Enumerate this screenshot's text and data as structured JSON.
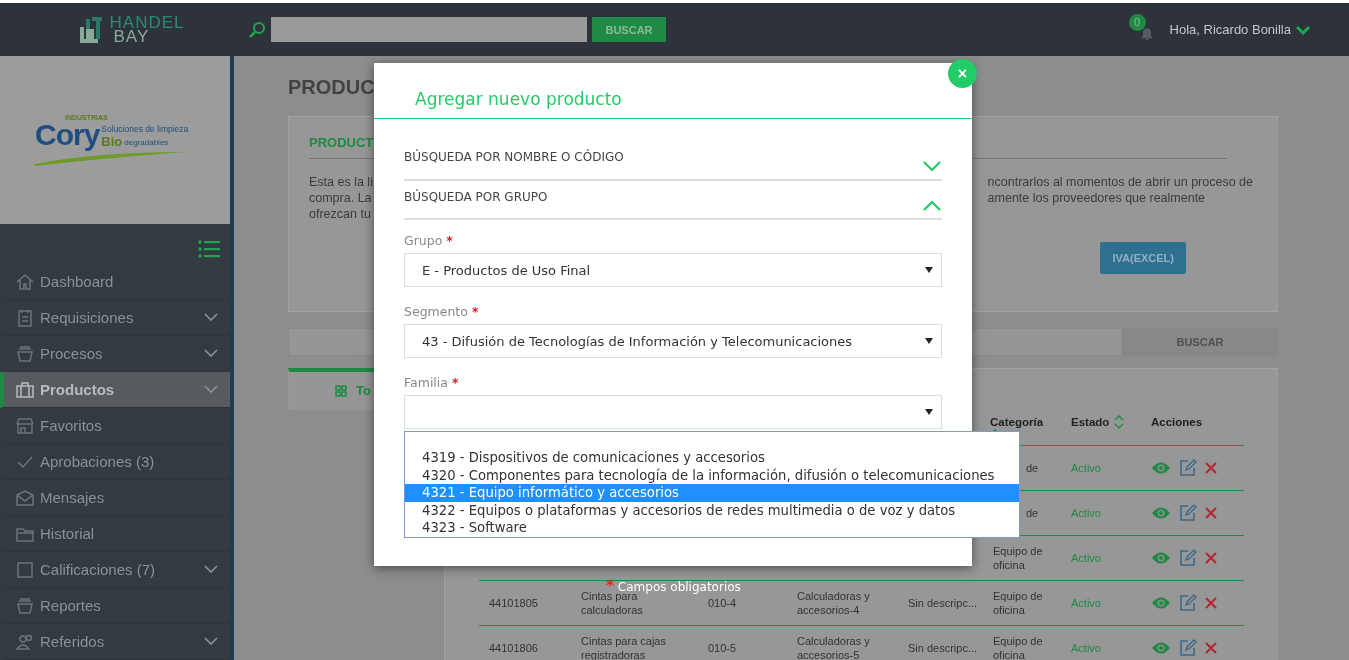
{
  "header": {
    "logo_top": "HANDEL",
    "logo_bottom": "BAY",
    "search": {
      "button": "BUSCAR"
    },
    "notifications": {
      "count": "0"
    },
    "user": "Hola, Ricardo Bonilla"
  },
  "sidebar": {
    "company_logo": {
      "small": "INDUSTRIAS",
      "name": "Cory",
      "tagline": "Soluciones de limpieza",
      "bio": "Bio",
      "tagline_2": "degradables"
    },
    "items": [
      {
        "label": "Dashboard",
        "expandable": false,
        "selected": false
      },
      {
        "label": "Requisiciones",
        "expandable": true,
        "selected": false
      },
      {
        "label": "Procesos",
        "expandable": true,
        "selected": false
      },
      {
        "label": "Productos",
        "expandable": true,
        "selected": true
      },
      {
        "label": "Favoritos",
        "expandable": false,
        "selected": false
      },
      {
        "label": "Aprobaciones (3)",
        "expandable": false,
        "selected": false
      },
      {
        "label": "Mensajes",
        "expandable": false,
        "selected": false
      },
      {
        "label": "Historial",
        "expandable": false,
        "selected": false
      },
      {
        "label": "Calificaciones (7)",
        "expandable": true,
        "selected": false
      },
      {
        "label": "Reportes",
        "expandable": false,
        "selected": false
      },
      {
        "label": "Referidos",
        "expandable": true,
        "selected": false
      }
    ]
  },
  "page": {
    "title": "PRODUC",
    "intro": {
      "title": "PRODUCT",
      "text_left": [
        "Esta es la li",
        "compra. La",
        "ofrezcan tu"
      ],
      "text_right": [
        "ncontrarlos al momentos de abrir un proceso de",
        "amente los proveedores que realmente"
      ],
      "button": "IVA(EXCEL)"
    },
    "search": {
      "button": "BUSCAR"
    },
    "tab": {
      "label": "To",
      "selected": true
    },
    "table": {
      "columns": [
        {
          "label": "Categoría",
          "sortable": true
        },
        {
          "label": "Estado",
          "sortable": true
        },
        {
          "label": "Acciones",
          "sortable": false
        }
      ],
      "rows": [
        {
          "category": "de",
          "status": "Activo"
        },
        {
          "category": "de",
          "status": "Activo"
        },
        {
          "category": "Equipo de oficina",
          "status": "Activo"
        },
        {
          "code": "44101805",
          "name": "Cintas para calculadoras",
          "ref": "010-4",
          "subcategory": "Calculadoras y accesorios-4",
          "description": "Sin descripc...",
          "category": "Equipo de oficina",
          "status": "Activo"
        },
        {
          "code": "44101806",
          "name": "Cintas para cajas registradoras",
          "ref": "010-5",
          "subcategory": "Calculadoras y accesorios-5",
          "description": "Sin descripc...",
          "category": "Equipo de oficina",
          "status": "Activo"
        }
      ]
    }
  },
  "modal": {
    "title": "Agregar nuevo producto",
    "close": "×",
    "sections": [
      {
        "label": "BÚSQUEDA POR NOMBRE O CÓDIGO",
        "expanded": false
      },
      {
        "label": "BÚSQUEDA POR GRUPO",
        "expanded": true
      }
    ],
    "fields": [
      {
        "label": "Grupo",
        "required_mark": "*",
        "value": "E - Productos de Uso Final"
      },
      {
        "label": "Segmento",
        "required_mark": "*",
        "value": "43 - Difusión de Tecnologías de Información y Telecomunicaciones"
      },
      {
        "label": "Familia",
        "required_mark": "*"
      }
    ],
    "dropdown": [
      {
        "label": "4319 - Dispositivos de comunicaciones y accesorios",
        "selected": false
      },
      {
        "label": "4320 - Componentes para tecnología de la información, difusión o telecomunicaciones",
        "selected": false
      },
      {
        "label": "4321 - Equipo informático y accesorios",
        "selected": true
      },
      {
        "label": "4322 - Equipos o plataformas y accesorios de redes multimedia o de voz y datos",
        "selected": false
      },
      {
        "label": "4323 - Software",
        "selected": false
      }
    ],
    "required_note": {
      "mark": "*",
      "text": "Campos obligatorios"
    }
  }
}
